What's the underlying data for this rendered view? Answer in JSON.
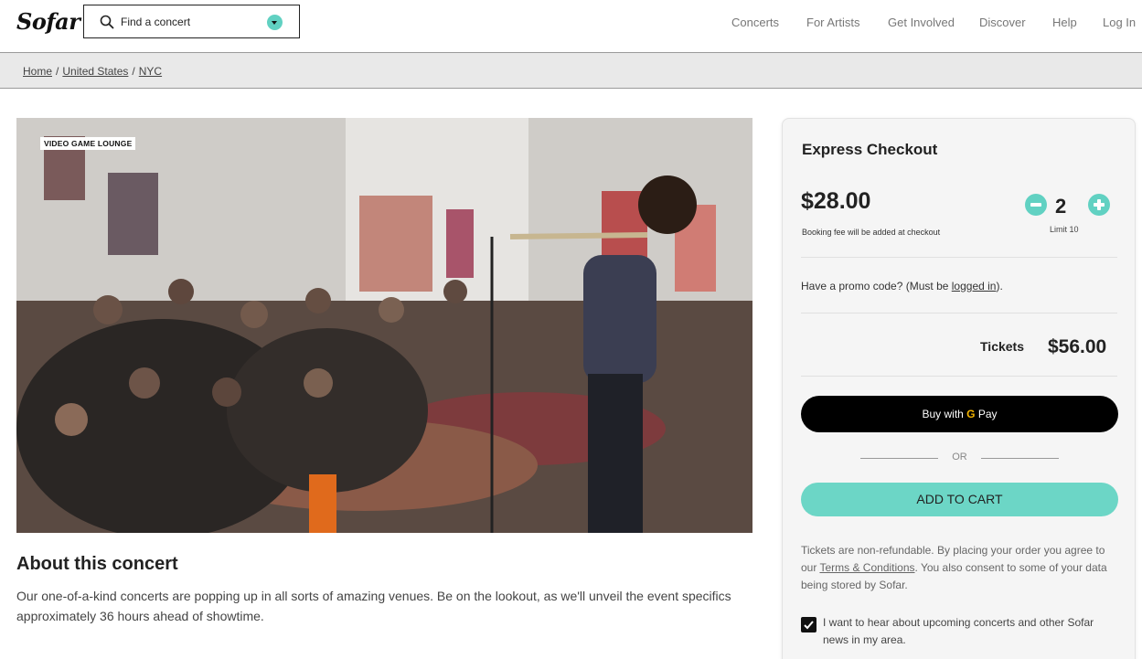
{
  "header": {
    "logo": "Sofar",
    "search_placeholder": "Find a concert",
    "nav": [
      "Concerts",
      "For Artists",
      "Get Involved",
      "Discover",
      "Help",
      "Log In"
    ]
  },
  "breadcrumb": [
    "Home",
    "United States",
    "NYC"
  ],
  "hero": {
    "tag": "VIDEO GAME LOUNGE"
  },
  "about": {
    "title": "About this concert",
    "text": "Our one-of-a-kind concerts are popping up in all sorts of amazing venues. Be on the lookout, as we'll unveil the event specifics approximately 36 hours ahead of showtime."
  },
  "checkout": {
    "title": "Express Checkout",
    "price": "$28.00",
    "fee_note": "Booking fee will be added at checkout",
    "quantity": "2",
    "limit": "Limit 10",
    "promo_prefix": "Have a promo code? (Must be ",
    "promo_link": "logged in",
    "promo_suffix": ").",
    "tickets_label": "Tickets",
    "tickets_total": "$56.00",
    "gpay_prefix": "Buy with ",
    "gpay_g": "G",
    "gpay_suffix": " Pay",
    "or": "OR",
    "add_to_cart": "ADD TO CART",
    "terms_1": "Tickets are non-refundable. By placing your order you agree to our ",
    "terms_link": "Terms & Conditions",
    "terms_2": ". You also consent to some of your data being stored by Sofar.",
    "optin": "I want to hear about upcoming concerts and other Sofar news in my area.",
    "optin_checked": true,
    "accent_color": "#61d1c2"
  }
}
